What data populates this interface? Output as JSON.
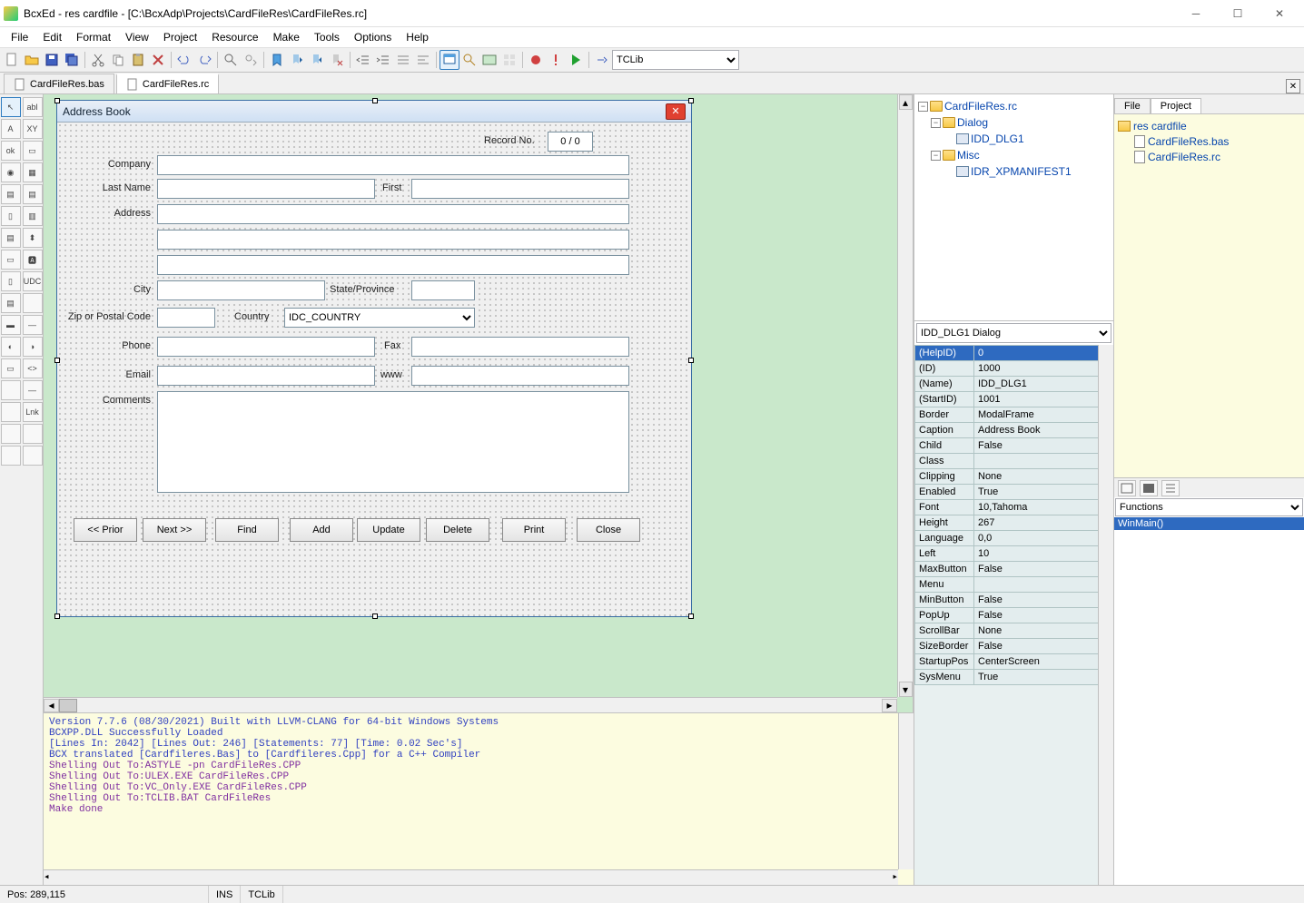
{
  "title": "BcxEd - res cardfile - [C:\\BcxAdp\\Projects\\CardFileRes\\CardFileRes.rc]",
  "menus": [
    "File",
    "Edit",
    "Format",
    "View",
    "Project",
    "Resource",
    "Make",
    "Tools",
    "Options",
    "Help"
  ],
  "toolbar_select": "TCLib",
  "tabs": {
    "items": [
      "CardFileRes.bas",
      "CardFileRes.rc"
    ],
    "active": 1
  },
  "right_tabs": {
    "items": [
      "File",
      "Project"
    ],
    "active": 1
  },
  "dialog": {
    "caption": "Address Book",
    "record_label": "Record No.",
    "record_value": "0 / 0",
    "labels": {
      "company": "Company",
      "last": "Last Name",
      "first": "First",
      "address": "Address",
      "city": "City",
      "state": "State/Province",
      "zip": "Zip or Postal Code",
      "country": "Country",
      "phone": "Phone",
      "fax": "Fax",
      "email": "Email",
      "www": "www",
      "comments": "Comments"
    },
    "country_value": "IDC_COUNTRY",
    "buttons": {
      "prior": "<<  Prior",
      "next": "Next  >>",
      "find": "Find",
      "add": "Add",
      "update": "Update",
      "delete": "Delete",
      "print": "Print",
      "close": "Close"
    }
  },
  "resource_tree": {
    "root": "CardFileRes.rc",
    "dialog_folder": "Dialog",
    "dialog_item": "IDD_DLG1",
    "misc_folder": "Misc",
    "misc_item": "IDR_XPMANIFEST1"
  },
  "props_select": "IDD_DLG1 Dialog",
  "props": [
    {
      "k": "(HelpID)",
      "v": "0",
      "sel": true
    },
    {
      "k": "(ID)",
      "v": "1000"
    },
    {
      "k": "(Name)",
      "v": "IDD_DLG1"
    },
    {
      "k": "(StartID)",
      "v": "1001"
    },
    {
      "k": "Border",
      "v": "ModalFrame"
    },
    {
      "k": "Caption",
      "v": "Address Book"
    },
    {
      "k": "Child",
      "v": "False"
    },
    {
      "k": "Class",
      "v": ""
    },
    {
      "k": "Clipping",
      "v": "None"
    },
    {
      "k": "Enabled",
      "v": "True"
    },
    {
      "k": "Font",
      "v": "10,Tahoma"
    },
    {
      "k": "Height",
      "v": "267"
    },
    {
      "k": "Language",
      "v": "0,0"
    },
    {
      "k": "Left",
      "v": "10"
    },
    {
      "k": "MaxButton",
      "v": "False"
    },
    {
      "k": "Menu",
      "v": ""
    },
    {
      "k": "MinButton",
      "v": "False"
    },
    {
      "k": "PopUp",
      "v": "False"
    },
    {
      "k": "ScrollBar",
      "v": "None"
    },
    {
      "k": "SizeBorder",
      "v": "False"
    },
    {
      "k": "StartupPos",
      "v": "CenterScreen"
    },
    {
      "k": "SysMenu",
      "v": "True"
    }
  ],
  "project": {
    "root": "res cardfile",
    "files": [
      "CardFileRes.bas",
      "CardFileRes.rc"
    ]
  },
  "functions_label": "Functions",
  "functions": [
    "WinMain()"
  ],
  "output_lines": [
    {
      "c": "blue",
      "t": "Version 7.7.6 (08/30/2021) Built with LLVM-CLANG for 64-bit Windows Systems"
    },
    {
      "c": "blue",
      "t": "BCXPP.DLL Successfully Loaded"
    },
    {
      "c": "blue",
      "t": "[Lines In: 2042] [Lines Out: 246] [Statements: 77] [Time: 0.02 Sec's]"
    },
    {
      "c": "blue",
      "t": "BCX translated [Cardfileres.Bas] to [Cardfileres.Cpp] for a C++ Compiler"
    },
    {
      "c": "blue",
      "t": ""
    },
    {
      "c": "purple",
      "t": "Shelling Out To:ASTYLE -pn CardFileRes.CPP"
    },
    {
      "c": "purple",
      "t": "Shelling Out To:ULEX.EXE CardFileRes.CPP"
    },
    {
      "c": "purple",
      "t": "Shelling Out To:VC_Only.EXE CardFileRes.CPP"
    },
    {
      "c": "purple",
      "t": "Shelling Out To:TCLIB.BAT CardFileRes"
    },
    {
      "c": "purple",
      "t": ""
    },
    {
      "c": "purple",
      "t": "Make done"
    }
  ],
  "status": {
    "pos": "Pos: 289,115",
    "ins": "INS",
    "lib": "TCLib"
  },
  "lt_lnk": "Lnk",
  "lt_udc": "UDC"
}
